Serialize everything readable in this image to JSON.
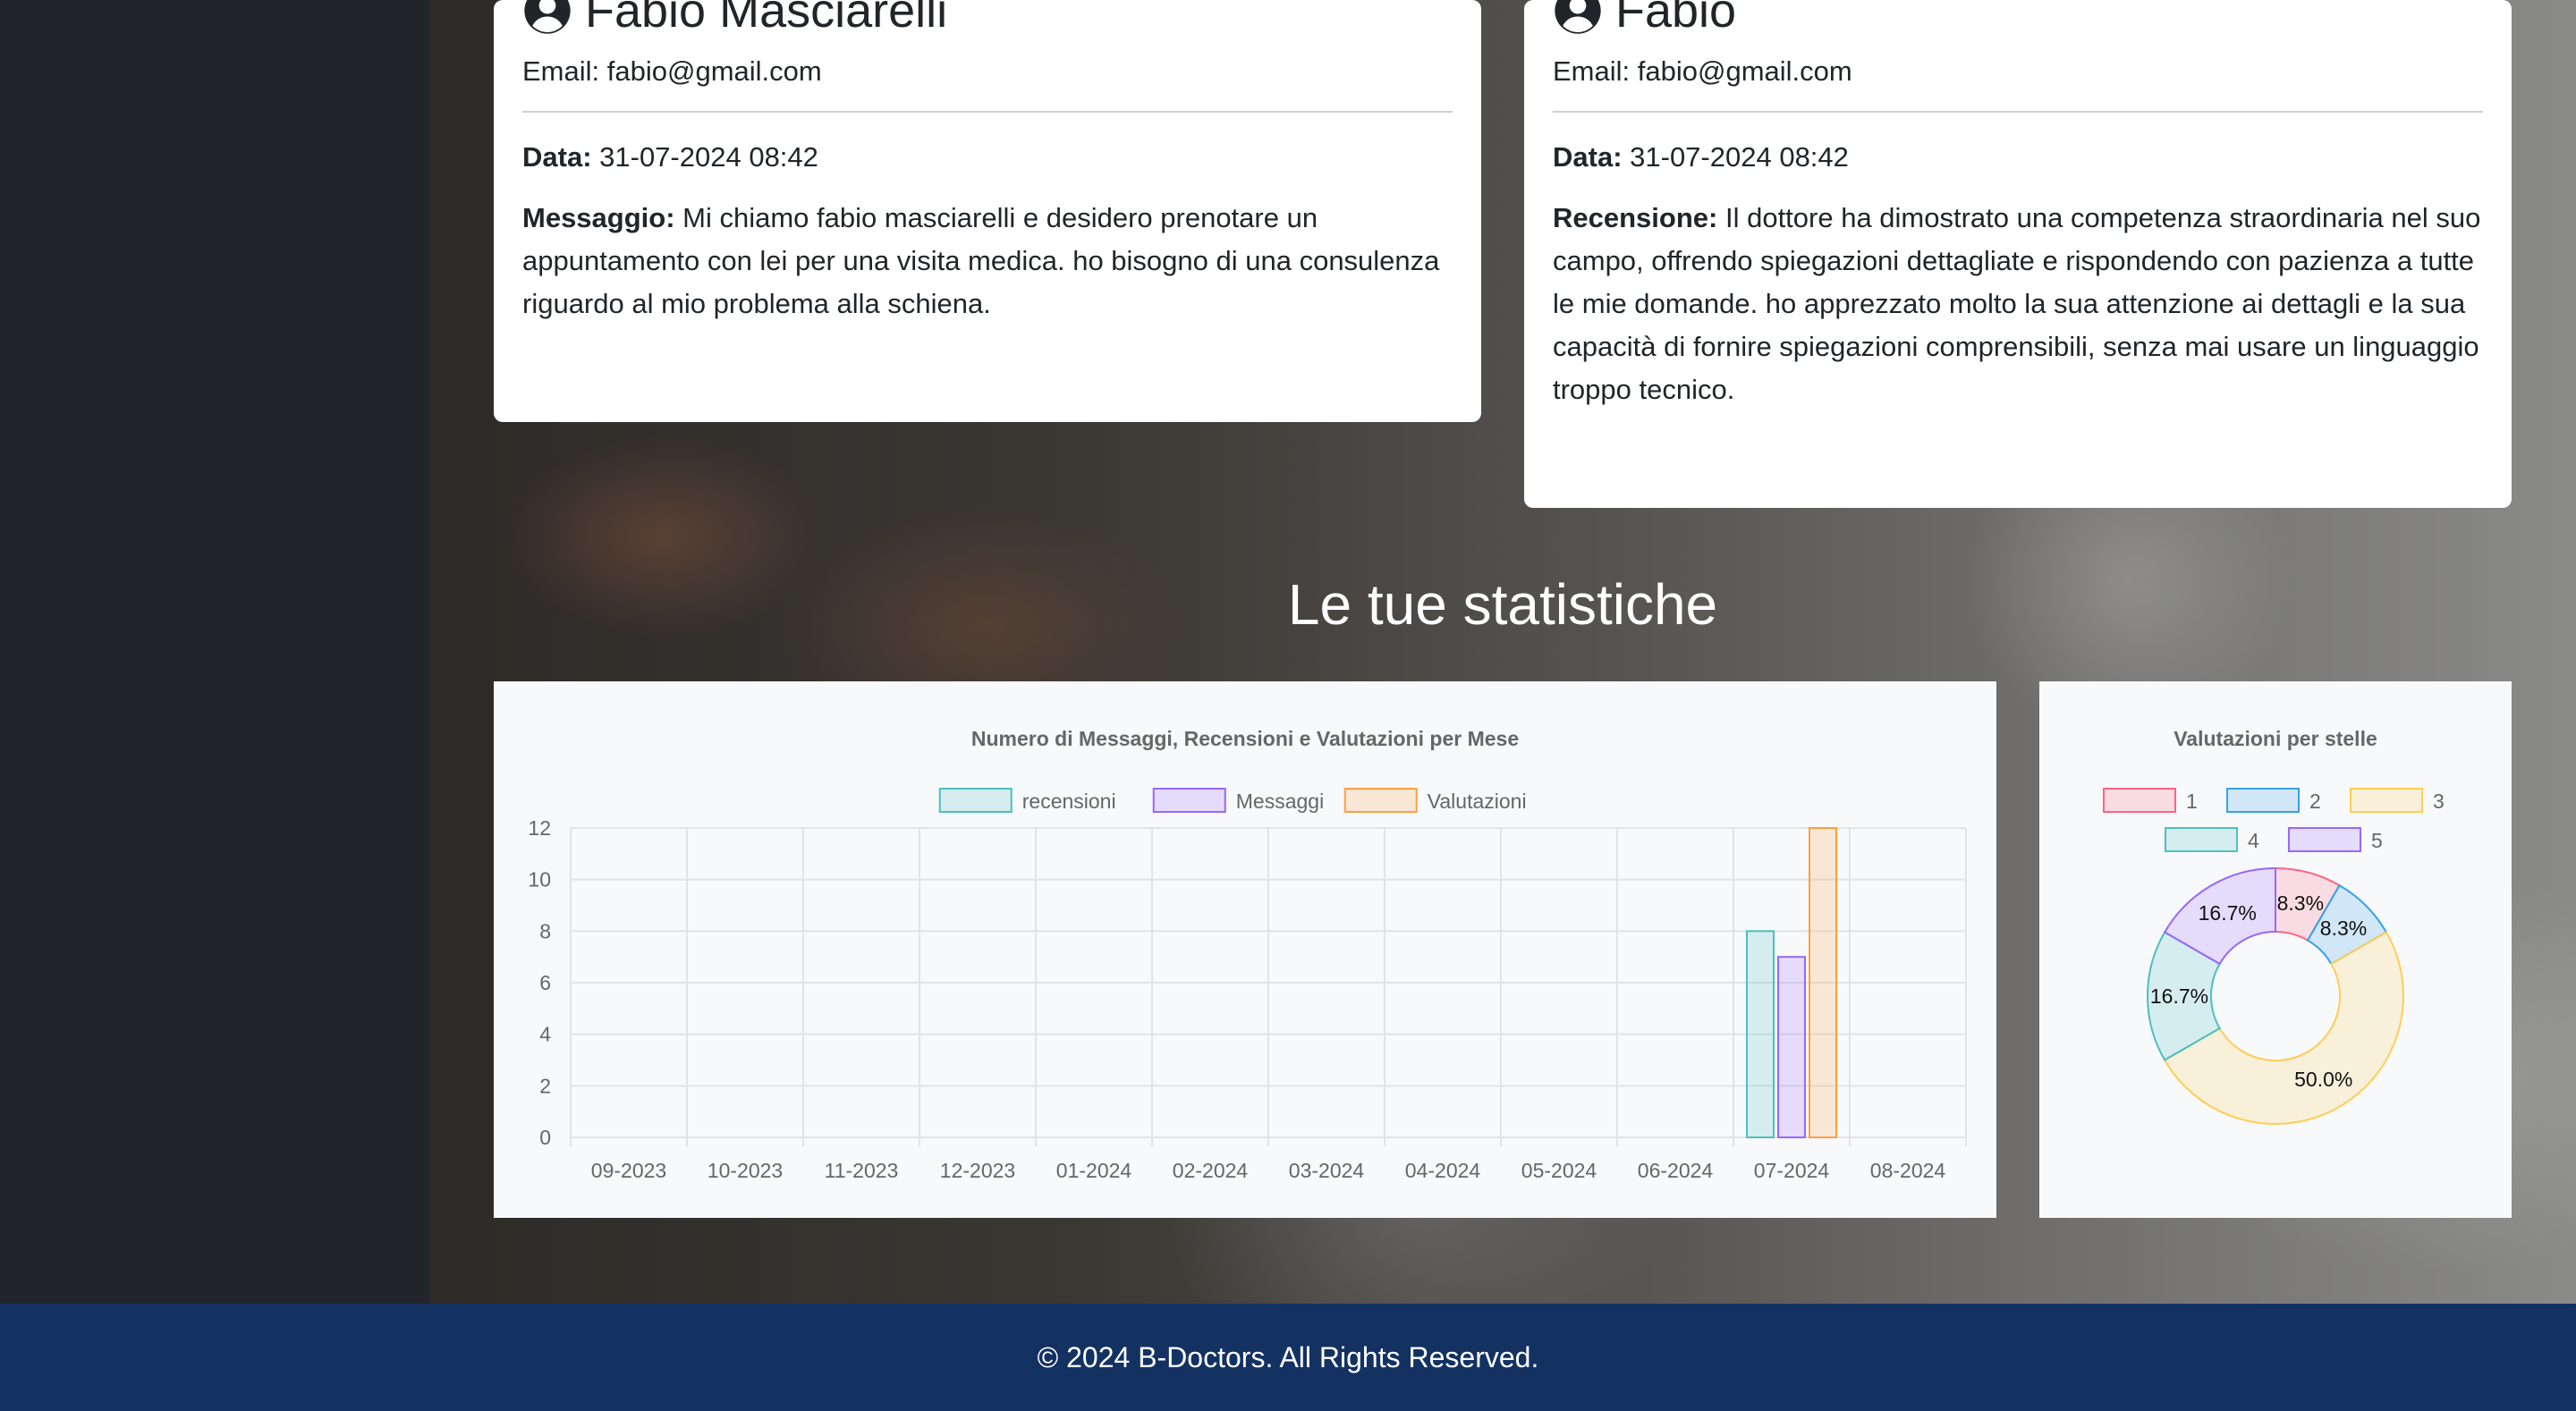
{
  "messages_card": {
    "name": "Fabio Masciarelli",
    "email_label": "Email:",
    "email": "fabio@gmail.com",
    "date_label": "Data:",
    "date": "31-07-2024 08:42",
    "text_label": "Messaggio:",
    "text": "Mi chiamo fabio masciarelli e desidero prenotare un appuntamento con lei per una visita medica. ho bisogno di una consulenza riguardo al mio problema alla schiena."
  },
  "review_card": {
    "name": "Fabio",
    "email_label": "Email:",
    "email": "fabio@gmail.com",
    "date_label": "Data:",
    "date": "31-07-2024 08:42",
    "text_label": "Recensione:",
    "text": "Il dottore ha dimostrato una competenza straordinaria nel suo campo, offrendo spiegazioni dettagliate e rispondendo con pazienza a tutte le mie domande. ho apprezzato molto la sua attenzione ai dettagli e la sua capacità di fornire spiegazioni comprensibili, senza mai usare un linguaggio troppo tecnico."
  },
  "stats_title": "Le tue statistiche",
  "footer": {
    "text": "© 2024 B-Doctors. All Rights Reserved."
  },
  "chart_data": [
    {
      "type": "bar",
      "title": "Numero di Messaggi, Recensioni e Valutazioni per Mese",
      "categories": [
        "09-2023",
        "10-2023",
        "11-2023",
        "12-2023",
        "01-2024",
        "02-2024",
        "03-2024",
        "04-2024",
        "05-2024",
        "06-2024",
        "07-2024",
        "08-2024"
      ],
      "series": [
        {
          "name": "recensioni",
          "values": [
            0,
            0,
            0,
            0,
            0,
            0,
            0,
            0,
            0,
            0,
            8,
            0
          ],
          "color": "#4bc0c0"
        },
        {
          "name": "Messaggi",
          "values": [
            0,
            0,
            0,
            0,
            0,
            0,
            0,
            0,
            0,
            0,
            7,
            0
          ],
          "color": "#9966ff"
        },
        {
          "name": "Valutazioni",
          "values": [
            0,
            0,
            0,
            0,
            0,
            0,
            0,
            0,
            0,
            0,
            12,
            0
          ],
          "color": "#ff9f40"
        }
      ],
      "yticks": [
        0,
        2,
        4,
        6,
        8,
        10,
        12
      ],
      "ylim": [
        0,
        12
      ],
      "legend": "top",
      "grid": true
    },
    {
      "type": "pie",
      "title": "Valutazioni per stelle",
      "labels": [
        "1",
        "2",
        "3",
        "4",
        "5"
      ],
      "values": [
        1,
        1,
        6,
        2,
        2
      ],
      "percent_labels": [
        "8.3%",
        "8.3%",
        "50.0%",
        "16.7%",
        "16.7%"
      ],
      "colors": [
        "#ff6384",
        "#36a2eb",
        "#ffcd56",
        "#4bc0c0",
        "#9966ff"
      ],
      "legend": "top"
    }
  ]
}
